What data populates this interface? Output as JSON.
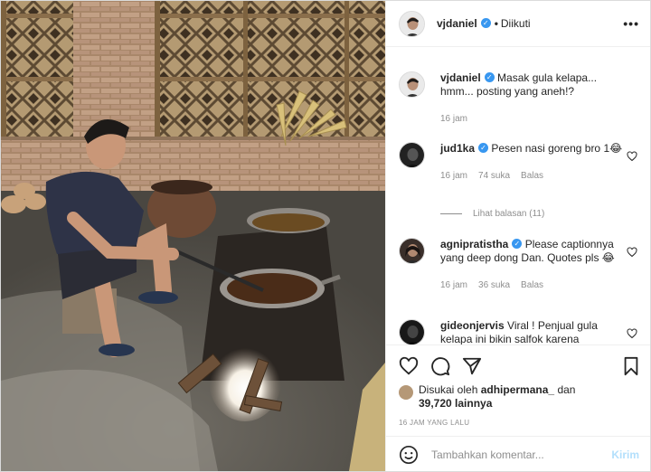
{
  "post": {
    "username": "vjdaniel",
    "verified_icon": "check-icon",
    "follow_status": "Diikuti",
    "more_icon": "more-horizontal-icon"
  },
  "caption": {
    "username": "vjdaniel",
    "text": "Masak gula kelapa... hmm... posting yang aneh!?",
    "time": "16 jam"
  },
  "comments": [
    {
      "username": "jud1ka",
      "text": "Pesen nasi goreng bro 1😂",
      "time": "16 jam",
      "likes": "74 suka",
      "reply": "Balas"
    },
    {
      "username": "agnipratistha",
      "text": "Please captionnya yang deep dong Dan. Quotes pls 😂",
      "time": "16 jam",
      "likes": "36 suka",
      "reply": "Balas"
    },
    {
      "username": "gideonjervis",
      "text": "Viral ! Penjual gula kelapa ini bikin salfok karena"
    }
  ],
  "view_replies": "Lihat balasan (11)",
  "likes": {
    "prefix": "Disukai oleh",
    "user": "adhipermana_",
    "joiner": "dan",
    "count": "39,720",
    "suffix": "lainnya"
  },
  "timestamp": "16 JAM YANG LALU",
  "add_comment": {
    "placeholder": "Tambahkan komentar...",
    "send": "Kirim"
  },
  "colors": {
    "verified": "#3897f0",
    "send": "#b2dffc",
    "meta": "#8e8e8e"
  }
}
